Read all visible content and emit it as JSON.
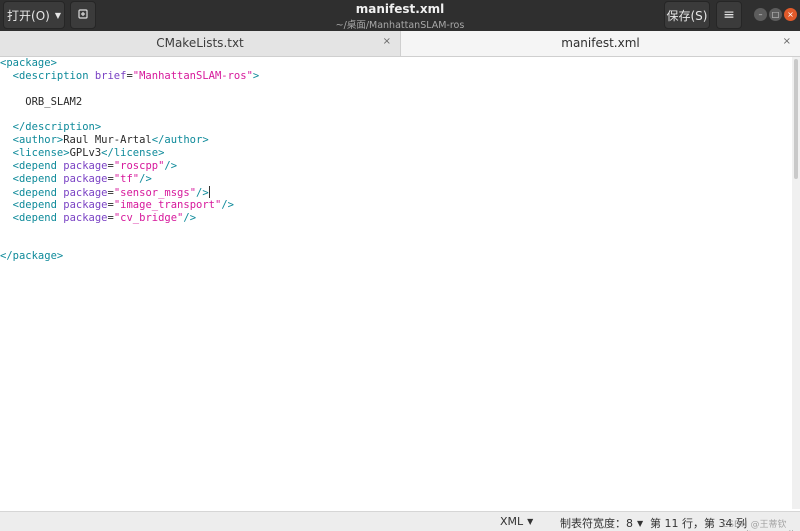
{
  "header": {
    "open_label": "打开(O)",
    "title": "manifest.xml",
    "subtitle": "~/桌面/ManhattanSLAM-ros",
    "save_label": "保存(S)"
  },
  "tabs": [
    {
      "label": "CMakeLists.txt",
      "close": "×"
    },
    {
      "label": "manifest.xml",
      "close": "×"
    }
  ],
  "editor": {
    "lines": [
      [
        {
          "t": "tg",
          "v": "<package>"
        }
      ],
      [
        {
          "t": "p",
          "v": "  "
        },
        {
          "t": "tg",
          "v": "<description"
        },
        {
          "t": "p",
          "v": " "
        },
        {
          "t": "at",
          "v": "brief"
        },
        {
          "t": "p",
          "v": "="
        },
        {
          "t": "st",
          "v": "\"ManhattanSLAM-ros\""
        },
        {
          "t": "tg",
          "v": ">"
        }
      ],
      [],
      [
        {
          "t": "p",
          "v": "    ORB_SLAM2"
        }
      ],
      [],
      [
        {
          "t": "p",
          "v": "  "
        },
        {
          "t": "tg",
          "v": "</description>"
        }
      ],
      [
        {
          "t": "p",
          "v": "  "
        },
        {
          "t": "tg",
          "v": "<author>"
        },
        {
          "t": "p",
          "v": "Raul Mur-Artal"
        },
        {
          "t": "tg",
          "v": "</author>"
        }
      ],
      [
        {
          "t": "p",
          "v": "  "
        },
        {
          "t": "tg",
          "v": "<license>"
        },
        {
          "t": "p",
          "v": "GPLv3"
        },
        {
          "t": "tg",
          "v": "</license>"
        }
      ],
      [
        {
          "t": "p",
          "v": "  "
        },
        {
          "t": "tg",
          "v": "<depend"
        },
        {
          "t": "p",
          "v": " "
        },
        {
          "t": "at",
          "v": "package"
        },
        {
          "t": "p",
          "v": "="
        },
        {
          "t": "st",
          "v": "\"roscpp\""
        },
        {
          "t": "tg",
          "v": "/>"
        }
      ],
      [
        {
          "t": "p",
          "v": "  "
        },
        {
          "t": "tg",
          "v": "<depend"
        },
        {
          "t": "p",
          "v": " "
        },
        {
          "t": "at",
          "v": "package"
        },
        {
          "t": "p",
          "v": "="
        },
        {
          "t": "st",
          "v": "\"tf\""
        },
        {
          "t": "tg",
          "v": "/>"
        }
      ],
      [
        {
          "t": "p",
          "v": "  "
        },
        {
          "t": "tg",
          "v": "<depend"
        },
        {
          "t": "p",
          "v": " "
        },
        {
          "t": "at",
          "v": "package"
        },
        {
          "t": "p",
          "v": "="
        },
        {
          "t": "st",
          "v": "\"sensor_msgs\""
        },
        {
          "t": "tg",
          "v": "/>"
        },
        {
          "t": "caret",
          "v": ""
        }
      ],
      [
        {
          "t": "p",
          "v": "  "
        },
        {
          "t": "tg",
          "v": "<depend"
        },
        {
          "t": "p",
          "v": " "
        },
        {
          "t": "at",
          "v": "package"
        },
        {
          "t": "p",
          "v": "="
        },
        {
          "t": "st",
          "v": "\"image_transport\""
        },
        {
          "t": "tg",
          "v": "/>"
        }
      ],
      [
        {
          "t": "p",
          "v": "  "
        },
        {
          "t": "tg",
          "v": "<depend"
        },
        {
          "t": "p",
          "v": " "
        },
        {
          "t": "at",
          "v": "package"
        },
        {
          "t": "p",
          "v": "="
        },
        {
          "t": "st",
          "v": "\"cv_bridge\""
        },
        {
          "t": "tg",
          "v": "/>"
        }
      ],
      [],
      [],
      [
        {
          "t": "tg",
          "v": "</package>"
        }
      ]
    ]
  },
  "status": {
    "language": "XML",
    "tab_width": "制表符宽度：8",
    "position": "第 11 行，第 34 列"
  },
  "watermark": "CSDN @王蒂钦 www.itpuyn.online",
  "colors": {
    "tag": "#0e8a9a",
    "attribute": "#7a42c4",
    "string": "#d6189b",
    "close_button": "#e15a2a",
    "header_bg": "#2f2f2f"
  },
  "icons": {
    "new_document": "new-document-icon",
    "menu": "hamburger-menu-icon"
  }
}
